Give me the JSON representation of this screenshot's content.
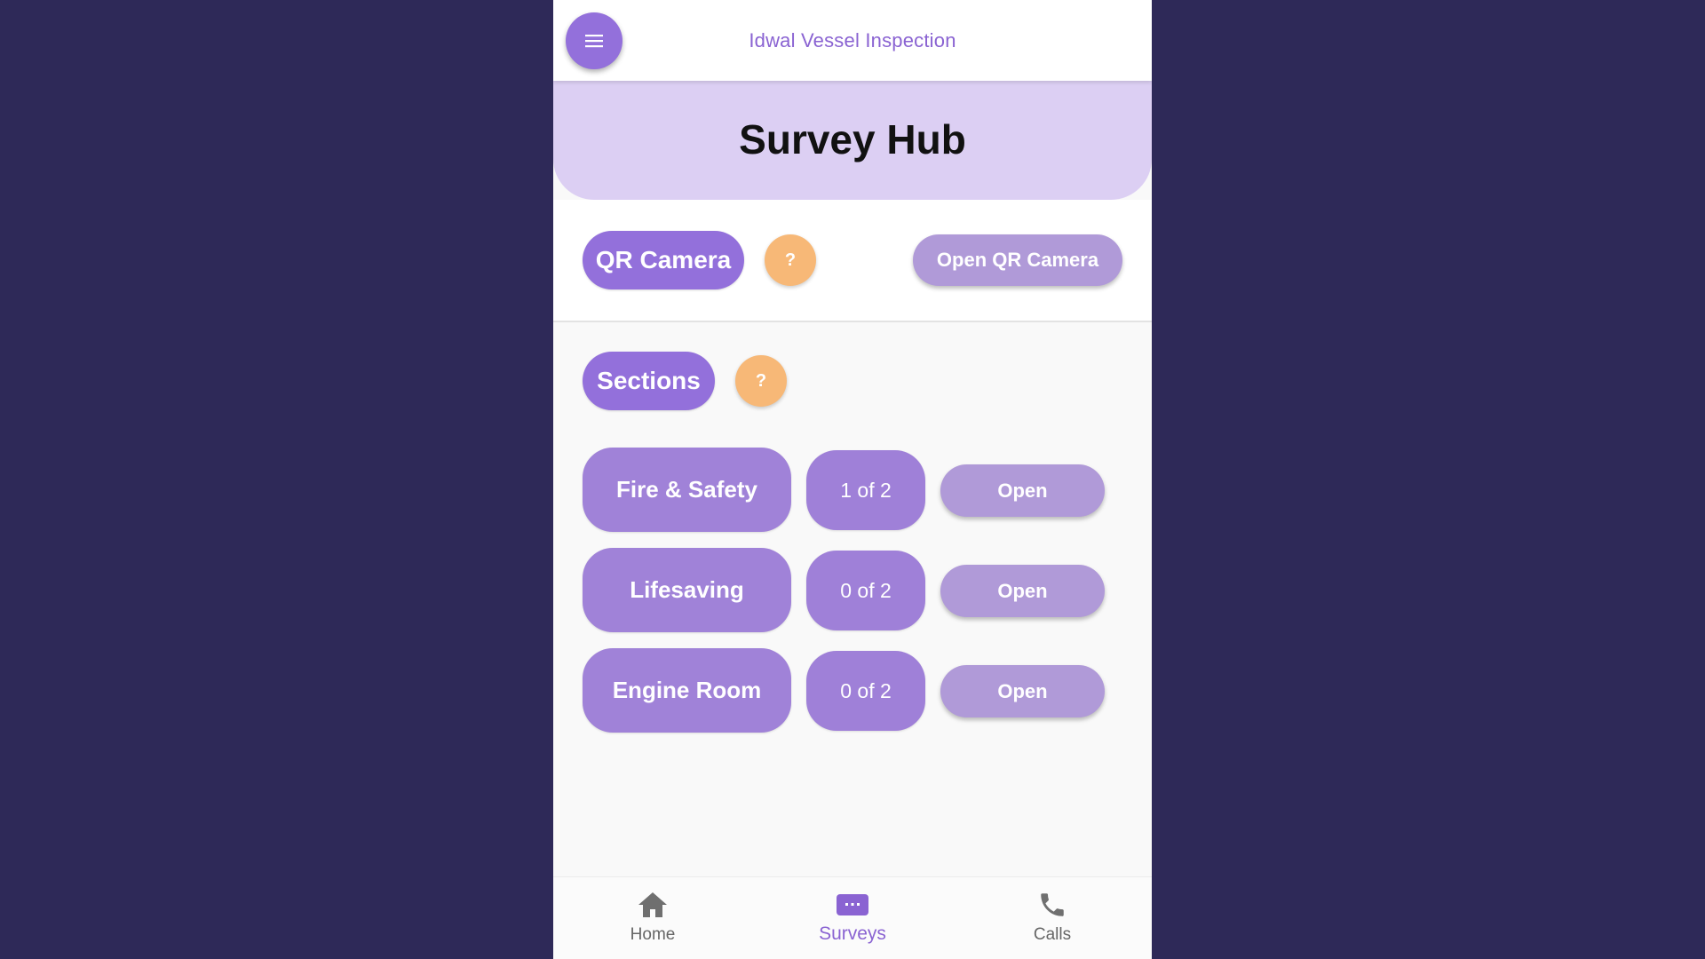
{
  "app_bar": {
    "title": "Idwal Vessel Inspection",
    "menu_icon": "menu-icon",
    "menu_color": "#9370db"
  },
  "header": {
    "title": "Survey Hub"
  },
  "qr": {
    "label": "QR Camera",
    "help": "?",
    "open_button": "Open QR Camera"
  },
  "sections": {
    "label": "Sections",
    "help": "?",
    "items": [
      {
        "name": "Fire & Safety",
        "progress": "1 of 2",
        "action": "Open"
      },
      {
        "name": "Lifesaving",
        "progress": "0 of 2",
        "action": "Open"
      },
      {
        "name": "Engine Room",
        "progress": "0 of 2",
        "action": "Open"
      }
    ]
  },
  "bottom_nav": {
    "items": [
      {
        "label": "Home",
        "icon": "home-icon",
        "active": false
      },
      {
        "label": "Surveys",
        "icon": "surveys-icon",
        "active": true
      },
      {
        "label": "Calls",
        "icon": "phone-icon",
        "active": false
      }
    ]
  },
  "colors": {
    "background": "#2e2958",
    "accent": "#9370db",
    "header_panel": "#dccff3",
    "help_orange": "#f7b877"
  }
}
